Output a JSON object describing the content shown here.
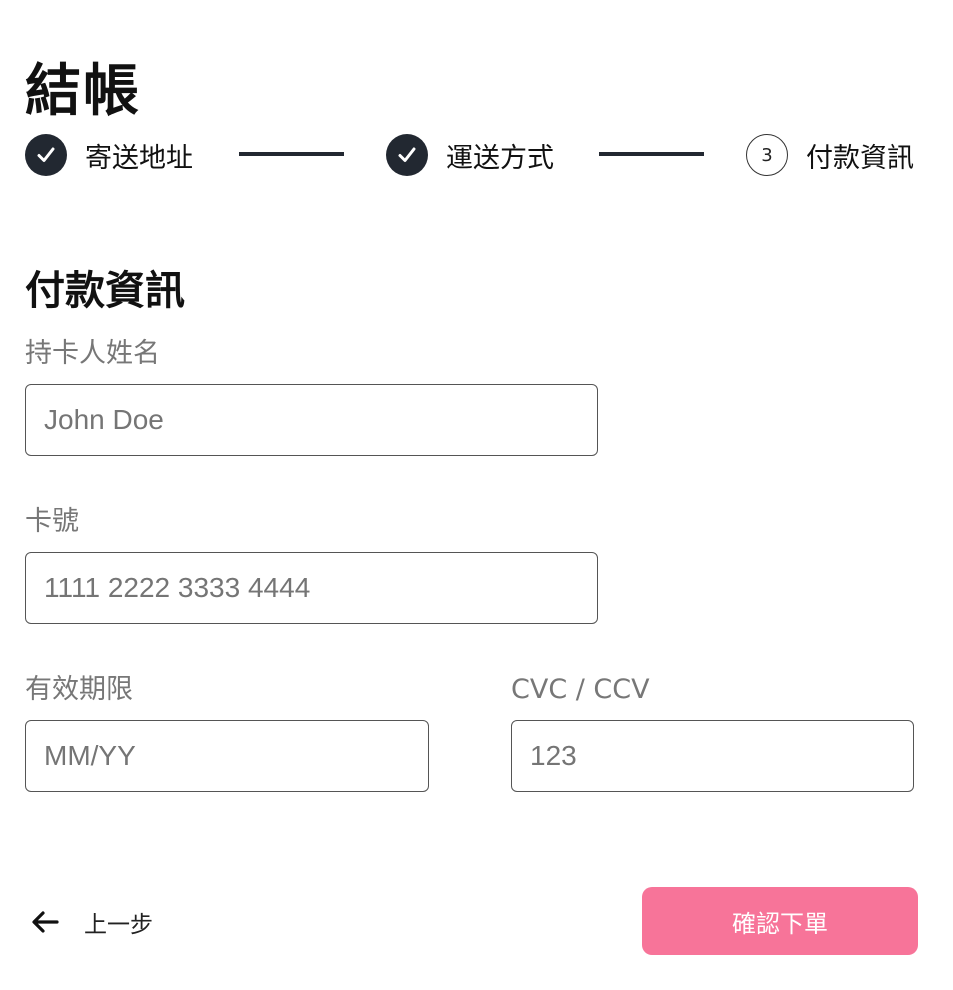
{
  "page": {
    "title": "結帳"
  },
  "stepper": {
    "steps": [
      {
        "label": "寄送地址",
        "status": "completed",
        "icon": "check-icon"
      },
      {
        "label": "運送方式",
        "status": "completed",
        "icon": "check-icon"
      },
      {
        "label": "付款資訊",
        "status": "current",
        "number": "3"
      }
    ]
  },
  "payment": {
    "heading": "付款資訊",
    "cardholder": {
      "label": "持卡人姓名",
      "placeholder": "John Doe",
      "value": ""
    },
    "card_number": {
      "label": "卡號",
      "placeholder": "1111 2222 3333 4444",
      "value": ""
    },
    "expiry": {
      "label": "有效期限",
      "placeholder": "MM/YY",
      "value": ""
    },
    "cvc": {
      "label": "CVC / CCV",
      "placeholder": "123",
      "value": ""
    }
  },
  "footer": {
    "back_label": "上一步",
    "back_icon": "arrow-left-icon",
    "confirm_label": "確認下單"
  },
  "colors": {
    "primary_dark": "#222831",
    "accent_pink": "#f77499",
    "label_gray": "#777777"
  }
}
